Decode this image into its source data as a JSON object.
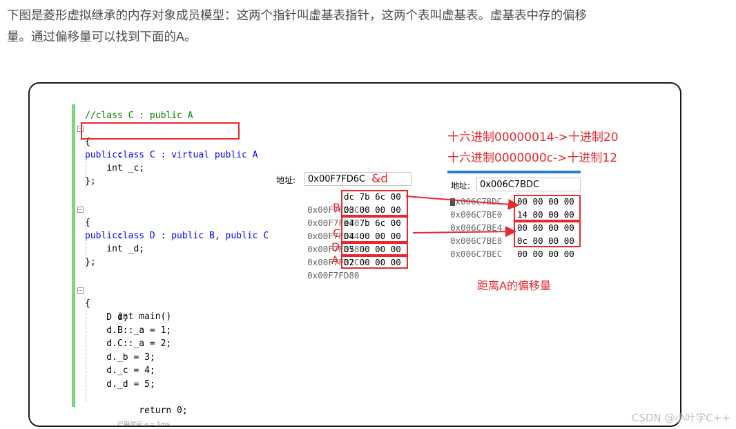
{
  "intro": {
    "line1": "下图是菱形虚拟继承的内存对象成员模型：这两个指针叫虚基表指针，这两个表叫虚基表。虚基表中存的偏移",
    "line2": "量。通过偏移量可以找到下面的A。"
  },
  "code": {
    "lines": [
      "//class C : public A",
      "class C : virtual public A",
      "{",
      "public:",
      "    int _c;",
      "};",
      "",
      "class D : public B, public C",
      "{",
      "public:",
      "    int _d;",
      "};",
      "",
      "int main()",
      "{",
      "    D d;",
      "    d.B::_a = 1;",
      "    d.C::_a = 2;",
      "    d._b = 3;",
      "    d._c = 4;",
      "    d._d = 5;",
      "    return 0;"
    ],
    "elapsed_hint": "已用时间 <= 1ms"
  },
  "memory1": {
    "address_label": "地址:",
    "address_value": "0x00F7FD6C",
    "address_note": "&d",
    "rows": [
      {
        "addr": "0x00F7FD6C",
        "tag": "",
        "bytes": "dc 7b 6c 00"
      },
      {
        "addr": "0x00F7FD70",
        "tag": "B",
        "bytes": "03 00 00 00"
      },
      {
        "addr": "0x00F7FD74",
        "tag": "",
        "bytes": "e4 7b 6c 00"
      },
      {
        "addr": "0x00F7FD78",
        "tag": "C",
        "bytes": "04 00 00 00"
      },
      {
        "addr": "0x00F7FD7C",
        "tag": "D",
        "bytes": "05 00 00 00"
      },
      {
        "addr": "0x00F7FD80",
        "tag": "A",
        "bytes": "02 00 00 00"
      }
    ]
  },
  "memory2": {
    "address_label": "地址:",
    "address_value": "0x006C7BDC",
    "rows": [
      {
        "addr": "0x006C7BDC",
        "bytes": "00 00 00 00"
      },
      {
        "addr": "0x006C7BE0",
        "bytes": "14 00 00 00"
      },
      {
        "addr": "0x006C7BE4",
        "bytes": "00 00 00 00"
      },
      {
        "addr": "0x006C7BE8",
        "bytes": "0c 00 00 00"
      },
      {
        "addr": "0x006C7BEC",
        "bytes": "00 00 00 00"
      }
    ]
  },
  "annotations": {
    "hex1": "十六进制00000014->十进制20",
    "hex2": "十六进制0000000c->十进制12",
    "offset_note": "距离A的偏移量"
  },
  "watermark": "CSDN @小叶学C++",
  "colors": {
    "accent_red": "#e8282e",
    "keyword_blue": "#0000ff",
    "comment_green": "#008000",
    "type_teal": "#2b91af",
    "gutter_green": "#7ed67a"
  }
}
